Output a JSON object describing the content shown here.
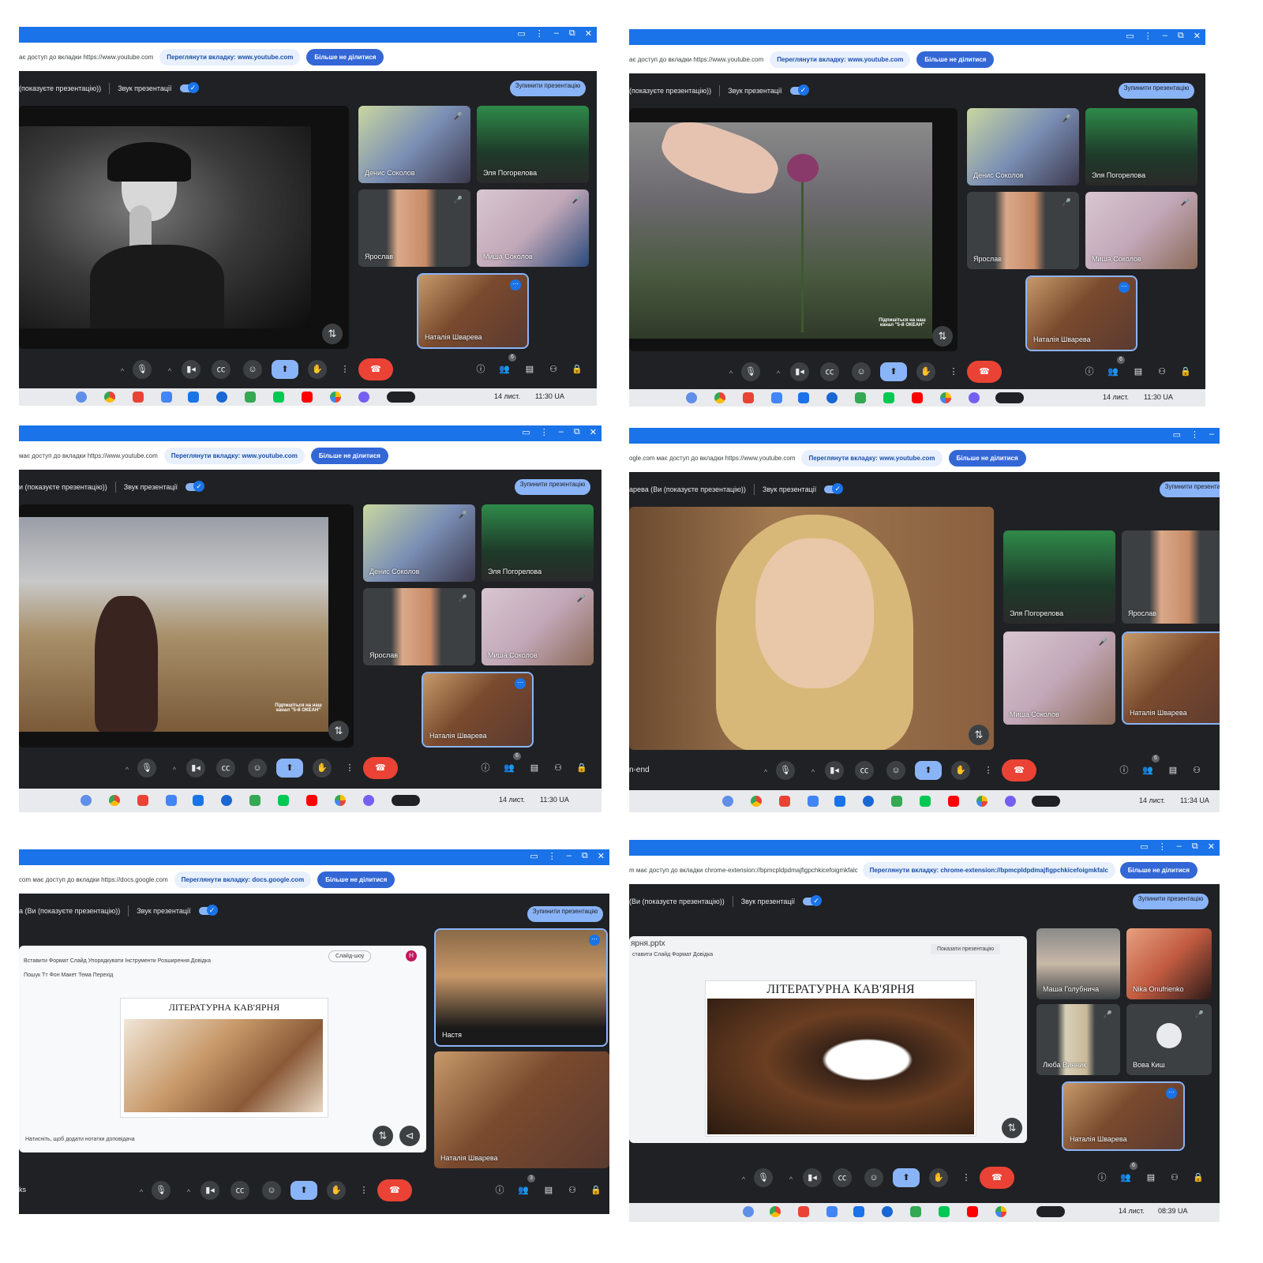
{
  "icons": {
    "camera": "▭",
    "more": "⋮",
    "minimize": "–",
    "restore": "⧉",
    "close": "✕",
    "mic": "🎙",
    "video": "▮◂",
    "captions": "㏄",
    "emoji": "☺",
    "present": "⬆",
    "hand": "✋",
    "end_call": "☎",
    "info": "ⓘ",
    "people": "👥",
    "chat": "▤",
    "activities": "⚇",
    "lock": "🔒",
    "swap": "⇅",
    "chevron_up": "^",
    "mute": "🎤",
    "dots": "⋯",
    "share": "⊲"
  },
  "colors": {
    "accent": "#1a73e8",
    "end_call": "#ea4335",
    "present_btn": "#8ab4f8",
    "meet_bg": "#202124"
  },
  "panels": [
    {
      "share_text": "ає доступ до вкладки https://www.youtube.com",
      "view_tab": "Переглянути вкладку: www.youtube.com",
      "stop_sharing": "Більше не ділитися",
      "presenting": "(показуєте презентацію))",
      "audio": "Звук презентації",
      "stop_presenting": "Зупинити презентацію",
      "tiles": [
        "Денис Соколов",
        "Эля Погорелова",
        "Ярослав",
        "Миша Соколов",
        "Наталія Шварева"
      ],
      "participants": "6",
      "date": "14 лист.",
      "time": "11:30 UA"
    },
    {
      "share_text": "ає доступ до вкладки https://www.youtube.com",
      "view_tab": "Переглянути вкладку: www.youtube.com",
      "stop_sharing": "Більше не ділитися",
      "presenting": "(показуєте презентацію))",
      "audio": "Звук презентації",
      "stop_presenting": "Зупинити презентацію",
      "video_caption": "Підпишіться на наш канал \"5-й ОКЕАН\"",
      "tiles": [
        "Денис Соколов",
        "Эля Погорелова",
        "Ярослав",
        "Миша Соколов",
        "Наталія Шварева"
      ],
      "participants": "6",
      "date": "14 лист.",
      "time": "11:30 UA"
    },
    {
      "share_text": "має доступ до вкладки https://www.youtube.com",
      "view_tab": "Переглянути вкладку: www.youtube.com",
      "stop_sharing": "Більше не ділитися",
      "presenting": "и (показуєте презентацію))",
      "audio": "Звук презентації",
      "stop_presenting": "Зупинити презентацію",
      "video_caption": "Підпишіться на наш канал \"5-й ОКЕАН\"",
      "tiles": [
        "Денис Соколов",
        "Эля Погорелова",
        "Ярослав",
        "Миша Соколов",
        "Наталія Шварева"
      ],
      "participants": "6",
      "date": "14 лист.",
      "time": "11:30 UA"
    },
    {
      "share_text": "ogle.com має доступ до вкладки https://www.youtube.com",
      "view_tab": "Переглянути вкладку: www.youtube.com",
      "stop_sharing": "Більше не ділитися",
      "presenting": "арева (Ви (показуєте презентацію))",
      "audio": "Звук презентації",
      "stop_presenting": "Зупинити презентацію",
      "meeting_label": "n-end",
      "tiles": [
        "Эля Погорелова",
        "Ярослав",
        "Миша Соколов",
        "Наталія Шварева"
      ],
      "participants": "6",
      "date": "14 лист.",
      "time": "11:34 UA"
    },
    {
      "share_text": "com має доступ до вкладки https://docs.google.com",
      "view_tab": "Переглянути вкладку: docs.google.com",
      "stop_sharing": "Більше не ділитися",
      "presenting": "а (Ви (показуєте презентацію))",
      "audio": "Звук презентації",
      "stop_presenting": "Зупинити презентацію",
      "slides_menu": "Вставити   Формат   Слайд   Упорядкувати   Інструменти   Розширення   Довідка",
      "slides_toolbar": "Пошук   Тт   Фон   Макет   Тема   Перехід",
      "slideshow_btn": "Слайд-шоу",
      "slide_title": "ЛІТЕРАТУРНА КАВ'ЯРНЯ",
      "notes_hint": "Натисніть, щоб додати нотатки доповідача",
      "meeting_label": "ks",
      "tiles": [
        "Настя",
        "Наталія Шварева"
      ],
      "participants": "3"
    },
    {
      "share_text": "m має доступ до вкладки chrome-extension://bpmcpldpdmajfigpchkicefoigmkfalc",
      "view_tab": "Переглянути вкладку: chrome-extension://bpmcpldpdmajfigpchkicefoigmkfalc",
      "stop_sharing": "Більше не ділитися",
      "presenting": "(Ви (показуєте презентацію))",
      "audio": "Звук презентації",
      "stop_presenting": "Зупинити презентацію",
      "file_name": "ярня.pptx",
      "menu": "ставити   Слайд   Формат   Довідка",
      "show_presentation": "Показати презентацію",
      "slide_title": "ЛІТЕРАТУРНА  КАВ'ЯРНЯ",
      "tiles": [
        "Маша Голубнича",
        "Nika Onufrienko",
        "Люба Винник",
        "Вова Киш",
        "Наталія Шварева"
      ],
      "participants": "6",
      "date": "14 лист.",
      "time": "08:39 UA"
    }
  ]
}
